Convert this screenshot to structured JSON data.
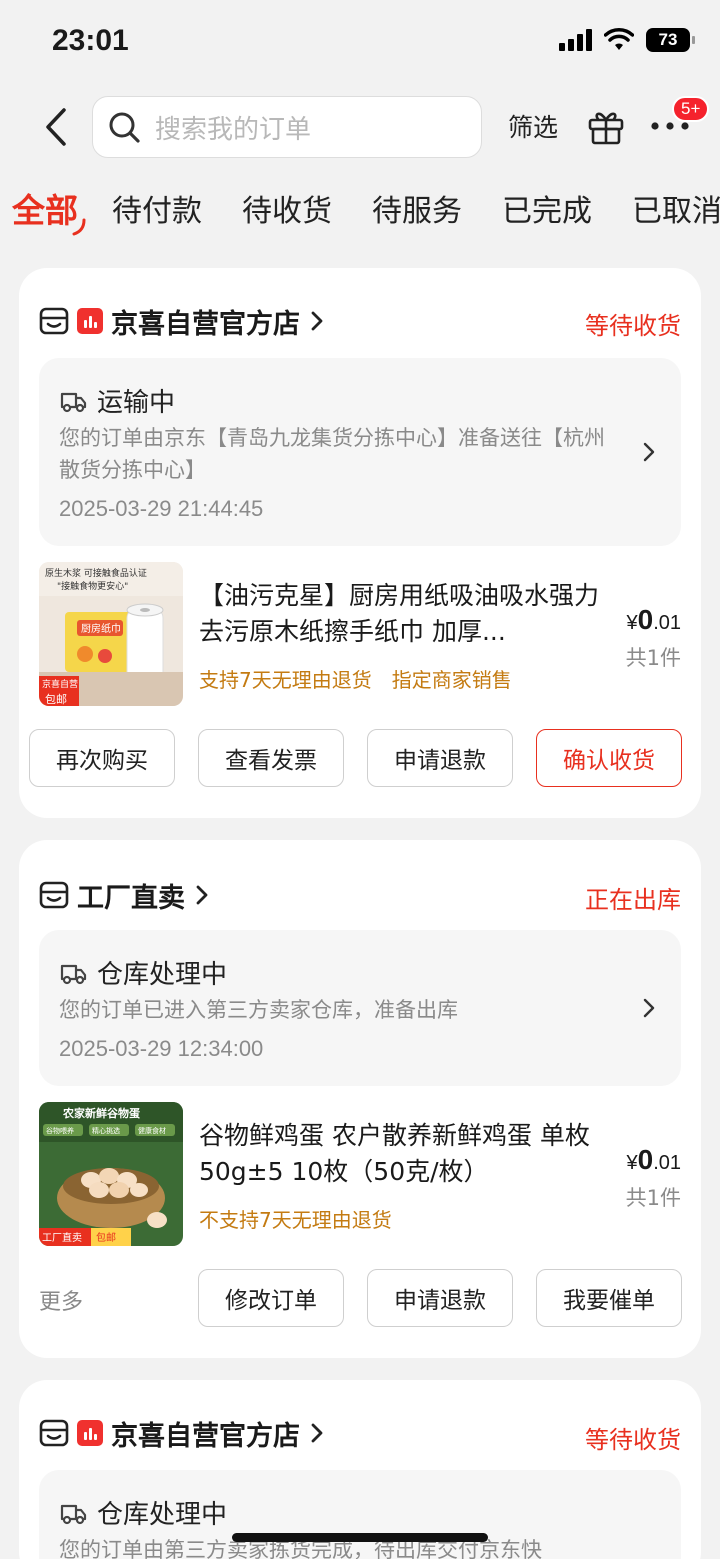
{
  "status_bar": {
    "time": "23:01",
    "battery": "73"
  },
  "header": {
    "search_placeholder": "搜索我的订单",
    "filter_label": "筛选",
    "notification_badge": "5+"
  },
  "tabs": [
    "全部",
    "待付款",
    "待收货",
    "待服务",
    "已完成",
    "已取消"
  ],
  "orders": [
    {
      "store_name": "京喜自营官方店",
      "status": "等待收货",
      "logistics": {
        "title": "运输中",
        "desc": "您的订单由京东【青岛九龙集货分拣中心】准备送往【杭州散货分拣中心】",
        "time": "2025-03-29 21:44:45"
      },
      "product": {
        "title": "【油污克星】厨房用纸吸油吸水强力去污原木纸擦手纸巾 加厚...",
        "tags": [
          "支持7天无理由退货",
          "指定商家销售"
        ],
        "price_symbol": "¥",
        "price_int": "0",
        "price_dec": ".01",
        "qty": "共1件",
        "image": {
          "top_text": "原生木浆 可接触食品认证",
          "sub_text": "\"接触食物更安心\"",
          "box_text": "厨房纸巾",
          "badge_left": "京喜自营",
          "badge_right": "包邮"
        }
      },
      "buttons": [
        "再次购买",
        "查看发票",
        "申请退款",
        "确认收货"
      ]
    },
    {
      "store_name": "工厂直卖",
      "status": "正在出库",
      "logistics": {
        "title": "仓库处理中",
        "desc": "您的订单已进入第三方卖家仓库，准备出库",
        "time": "2025-03-29 12:34:00"
      },
      "product": {
        "title": "谷物鲜鸡蛋 农户散养新鲜鸡蛋 单枚50g±5 10枚（50克/枚）",
        "tags": [
          "不支持7天无理由退货"
        ],
        "price_symbol": "¥",
        "price_int": "0",
        "price_dec": ".01",
        "qty": "共1件",
        "image": {
          "top_text": "农家新鲜谷物蛋",
          "chips": [
            "谷物喂养",
            "精心挑选",
            "健康食材"
          ],
          "badge_left": "工厂直卖",
          "badge_right": "包邮"
        }
      },
      "more_label": "更多",
      "buttons": [
        "修改订单",
        "申请退款",
        "我要催单"
      ]
    },
    {
      "store_name": "京喜自营官方店",
      "status": "等待收货",
      "logistics": {
        "title": "仓库处理中",
        "desc": "您的订单由第三方卖家拣货完成，待出库交付京东快"
      }
    }
  ],
  "colors": {
    "accent": "#e8301f",
    "tag": "#c47b12",
    "bg": "#f2f2f2"
  }
}
